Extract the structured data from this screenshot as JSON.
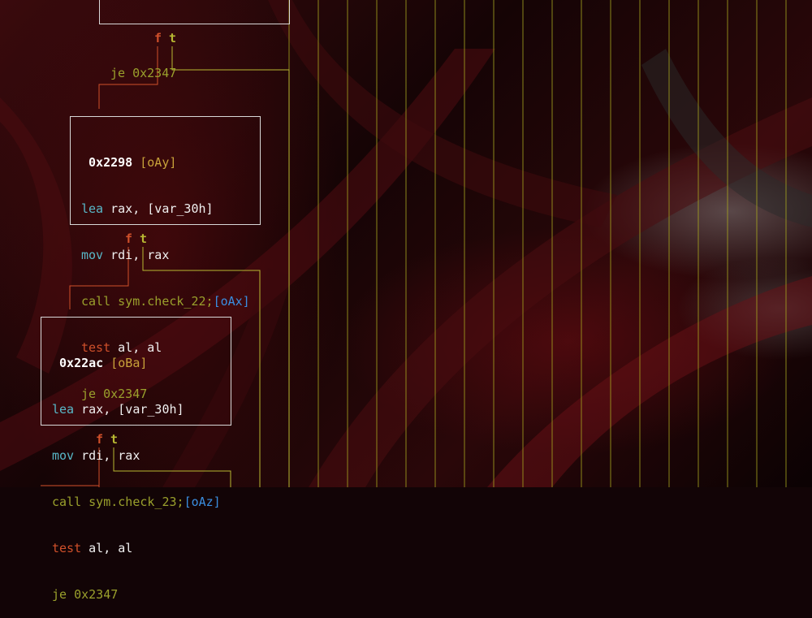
{
  "colors": {
    "edge_false": "#d0502a",
    "edge_true": "#b8b832",
    "node_border": "#d8d8d8",
    "vline": "#a8a820"
  },
  "top_fragment": {
    "line": {
      "mnemonic": "je",
      "target": "0x2347"
    }
  },
  "nodes": [
    {
      "address": "0x2298",
      "ref": "[oAy]",
      "lines": [
        {
          "mnemonic": "lea",
          "operands": "rax, [var_30h]"
        },
        {
          "mnemonic": "mov",
          "operands": "rdi, rax"
        },
        {
          "mnemonic": "call",
          "operands": "sym.check_22;",
          "xref": "[oAx]"
        },
        {
          "mnemonic": "test",
          "operands": "al, al"
        },
        {
          "mnemonic": "je",
          "operands": "0x2347"
        }
      ]
    },
    {
      "address": "0x22ac",
      "ref": "[oBa]",
      "lines": [
        {
          "mnemonic": "lea",
          "operands": "rax, [var_30h]"
        },
        {
          "mnemonic": "mov",
          "operands": "rdi, rax"
        },
        {
          "mnemonic": "call",
          "operands": "sym.check_23;",
          "xref": "[oAz]"
        },
        {
          "mnemonic": "test",
          "operands": "al, al"
        },
        {
          "mnemonic": "je",
          "operands": "0x2347"
        }
      ]
    }
  ],
  "edge_labels": {
    "false_label": "f",
    "true_label": "t"
  }
}
